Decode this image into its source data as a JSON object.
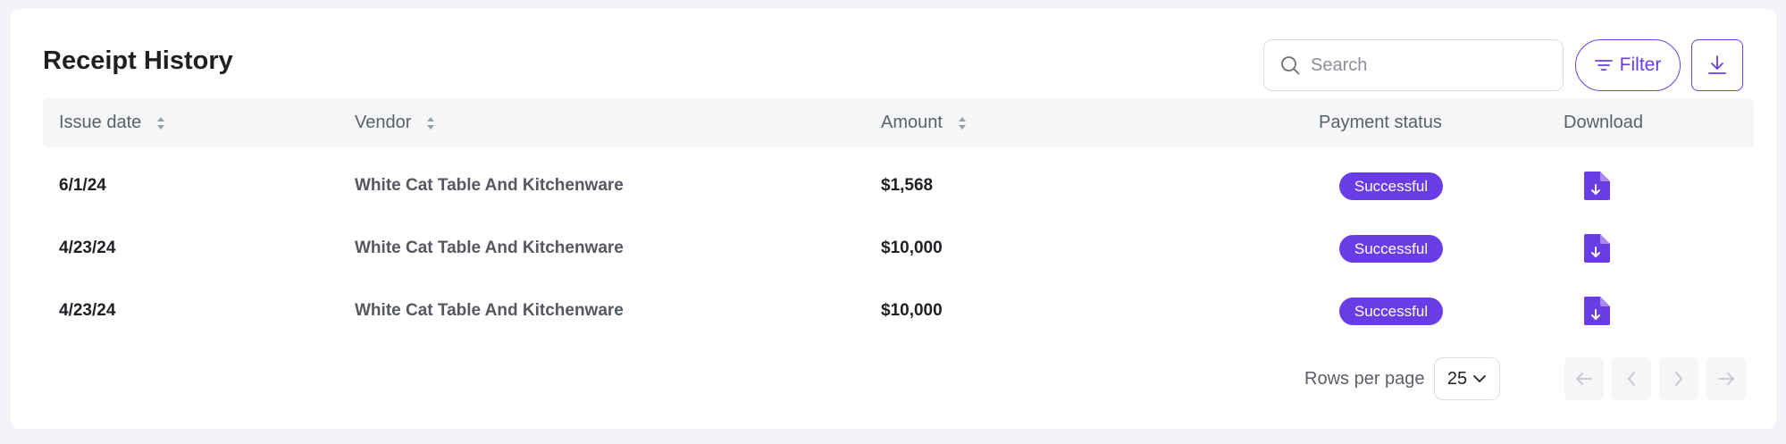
{
  "title": "Receipt History",
  "search": {
    "placeholder": "Search",
    "value": ""
  },
  "toolbar": {
    "filter_label": "Filter"
  },
  "columns": {
    "issue_date": "Issue date",
    "vendor": "Vendor",
    "amount": "Amount",
    "payment_status": "Payment status",
    "download": "Download"
  },
  "rows": [
    {
      "date": "6/1/24",
      "vendor": "White Cat Table And Kitchenware",
      "amount": "$1,568",
      "status": "Successful"
    },
    {
      "date": "4/23/24",
      "vendor": "White Cat Table And Kitchenware",
      "amount": "$10,000",
      "status": "Successful"
    },
    {
      "date": "4/23/24",
      "vendor": "White Cat Table And Kitchenware",
      "amount": "$10,000",
      "status": "Successful"
    }
  ],
  "pagination": {
    "rows_label": "Rows per page",
    "rows_value": "25"
  },
  "icons": {
    "search": "search-icon",
    "filter": "filter-icon",
    "download": "download-icon",
    "sort": "sort-icon",
    "file_download": "file-download-icon",
    "chevron": "chevron-down-icon",
    "first": "arrow-left-icon",
    "prev": "chevron-left-icon",
    "next": "chevron-right-icon",
    "last": "arrow-right-icon"
  },
  "colors": {
    "accent": "#6a3ce6",
    "header_bg": "#f5f6f8",
    "page_bg": "#f3f4f8"
  }
}
